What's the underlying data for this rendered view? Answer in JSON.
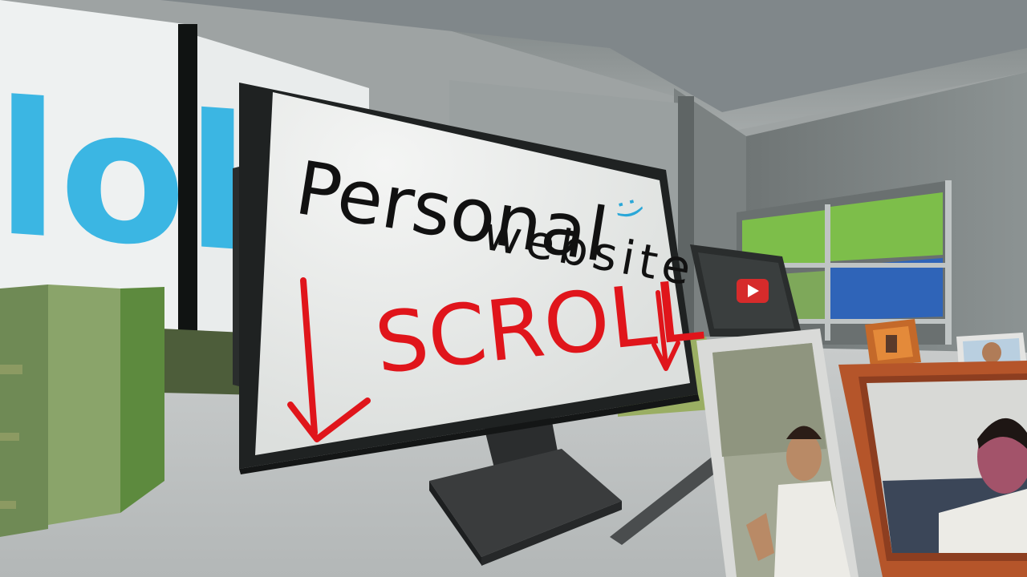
{
  "scene": {
    "monitor_screen": {
      "line1": "Personal",
      "smiley": ":)",
      "line2": "website",
      "scroll_label": "SCROLL",
      "arrow_glyph": "↓"
    },
    "wall_banner_fragment": "lol",
    "tv_icon": "play-icon"
  },
  "colors": {
    "ink_black": "#111111",
    "ink_red": "#e0151b",
    "ink_blue": "#2aa7d8",
    "banner_blue": "#3bb6e3",
    "folder_green": "#7dbe4a",
    "folder_blue": "#2f64b8",
    "frame_wood": "#b5552a"
  }
}
